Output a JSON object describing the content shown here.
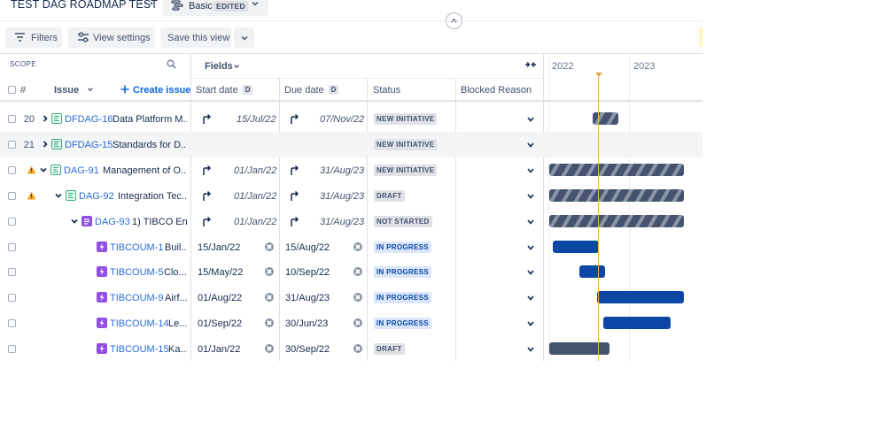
{
  "header": {
    "title": "TEST DAG ROADMAP TEST",
    "more_icon": "more-icon",
    "view_name": "Basic",
    "view_badge": "EDITED"
  },
  "toolbar": {
    "filters_label": "Filters",
    "view_settings_label": "View settings",
    "save_view_label": "Save this view"
  },
  "grid": {
    "scope_label": "SCOPE",
    "fields_label": "Fields",
    "columns": {
      "number": "#",
      "issue": "Issue",
      "create_issue": "Create issue",
      "start_date": "Start date",
      "start_badge": "D",
      "due_date": "Due date",
      "due_badge": "D",
      "status": "Status",
      "blocked_reason": "Blocked Reason"
    }
  },
  "timeline": {
    "years": [
      "2022",
      "2023"
    ],
    "today_marker_color": "#e9a23b"
  },
  "colors": {
    "epic_green": "#36b37e",
    "task_purple": "#904ee2",
    "link_blue": "#2a6bd6",
    "bar_blue": "#0c47a6",
    "bar_dark": "#44546f",
    "warning": "#f5a623"
  },
  "rows": [
    {
      "num": "20",
      "key": "DFDAG-16",
      "summary": "Data Platform M...",
      "start": "15/Jul/22",
      "due": "07/Nov/22",
      "status": "NEW INITIATIVE",
      "icon": "epic-icon",
      "date_style": "rolled-up"
    },
    {
      "num": "21",
      "key": "DFDAG-15",
      "summary": "Standards for D...",
      "start": "",
      "due": "",
      "status": "NEW INITIATIVE",
      "icon": "epic-icon",
      "date_style": "none"
    },
    {
      "num": "",
      "key": "DAG-91",
      "summary": "Management of O...",
      "start": "01/Jan/22",
      "due": "31/Aug/23",
      "status": "NEW INITIATIVE",
      "icon": "epic-icon",
      "date_style": "rolled-up"
    },
    {
      "num": "",
      "key": "DAG-92",
      "summary": "Integration Tec...",
      "start": "01/Jan/22",
      "due": "31/Aug/23",
      "status": "DRAFT",
      "icon": "epic-icon",
      "date_style": "rolled-up"
    },
    {
      "num": "",
      "key": "DAG-93",
      "summary": "1) TIBCO En...",
      "start": "01/Jan/22",
      "due": "31/Aug/23",
      "status": "NOT STARTED",
      "icon": "story-icon",
      "date_style": "rolled-up"
    },
    {
      "num": "",
      "key": "TIBCOUM-1",
      "summary": "Buil...",
      "start": "15/Jan/22",
      "due": "15/Aug/22",
      "status": "IN PROGRESS",
      "icon": "subtask-icon",
      "date_style": "set"
    },
    {
      "num": "",
      "key": "TIBCOUM-5",
      "summary": "Clo...",
      "start": "15/May/22",
      "due": "10/Sep/22",
      "status": "IN PROGRESS",
      "icon": "subtask-icon",
      "date_style": "set"
    },
    {
      "num": "",
      "key": "TIBCOUM-9",
      "summary": "Airf...",
      "start": "01/Aug/22",
      "due": "31/Aug/23",
      "status": "IN PROGRESS",
      "icon": "subtask-icon",
      "date_style": "set"
    },
    {
      "num": "",
      "key": "TIBCOUM-14",
      "summary": "Le...",
      "start": "01/Sep/22",
      "due": "30/Jun/23",
      "status": "IN PROGRESS",
      "icon": "subtask-icon",
      "date_style": "set"
    },
    {
      "num": "",
      "key": "TIBCOUM-15",
      "summary": "Ka...",
      "start": "01/Jan/22",
      "due": "30/Sep/22",
      "status": "DRAFT",
      "icon": "subtask-icon",
      "date_style": "set"
    }
  ]
}
